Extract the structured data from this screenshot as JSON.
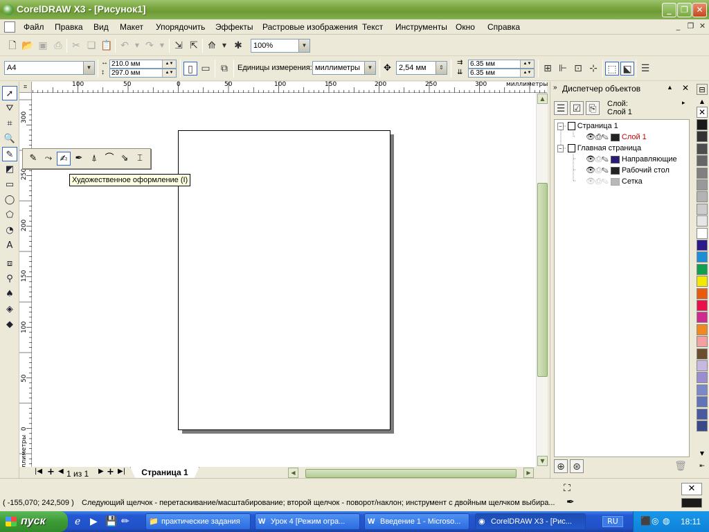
{
  "window": {
    "title": "CorelDRAW X3 - [Рисунок1]"
  },
  "menubar": {
    "items": [
      "Файл",
      "Правка",
      "Вид",
      "Макет",
      "Упорядочить",
      "Эффекты",
      "Растровые изображения",
      "Текст",
      "Инструменты",
      "Окно",
      "Справка"
    ]
  },
  "standard_toolbar": {
    "zoom": "100%"
  },
  "property_bar": {
    "paper_size": "A4",
    "width": "210.0 мм",
    "height": "297.0 мм",
    "units_label": "Единицы измерения:",
    "units_value": "миллиметры",
    "nudge": "2,54 мм",
    "dup_x": "6.35 мм",
    "dup_y": "6.35 мм"
  },
  "flyout": {
    "tooltip": "Художественное оформление (I)"
  },
  "ruler": {
    "h_labels": [
      "100",
      "50",
      "0",
      "50",
      "100",
      "150",
      "200",
      "250",
      "300"
    ],
    "h_units": "миллиметры",
    "v_labels": [
      "300",
      "250",
      "200",
      "150",
      "100",
      "50",
      "0"
    ],
    "v_units": "миллиметры"
  },
  "page_nav": {
    "counter": "1 из 1",
    "tab": "Страница 1"
  },
  "docker": {
    "title": "Диспетчер объектов",
    "layer_label": "Слой:",
    "layer_value": "Слой 1",
    "tree": [
      {
        "label": "Страница 1",
        "type": "page"
      },
      {
        "label": "Слой 1",
        "type": "layer",
        "color": "#222222",
        "highlight": true
      },
      {
        "label": "Главная страница",
        "type": "page"
      },
      {
        "label": "Направляющие",
        "type": "layer",
        "color": "#2b1a7a"
      },
      {
        "label": "Рабочий стол",
        "type": "layer",
        "color": "#222222"
      },
      {
        "label": "Сетка",
        "type": "layer",
        "color": "#b8b8b8",
        "disabled": true
      }
    ]
  },
  "palette": {
    "colors": [
      "#1a1a1a",
      "#333333",
      "#4d4d4d",
      "#666666",
      "#808080",
      "#999999",
      "#b3b3b3",
      "#cccccc",
      "#e6e6e6",
      "#ffffff",
      "#2a1a8a",
      "#1e8fd6",
      "#12a050",
      "#f4e800",
      "#e85c0c",
      "#e8104a",
      "#d02a90",
      "#f08a20",
      "#f4a0a0",
      "#6b4e2e",
      "#c6b8e0",
      "#9a8ed0",
      "#7a8ac8",
      "#6274b8",
      "#4a5aa0",
      "#3a4a88"
    ]
  },
  "statusbar": {
    "coords": "( -155,070; 242,509 )",
    "message": "Следующий щелчок - перетаскивание/масштабирование; второй щелчок - поворот/наклон; инструмент с двойным щелчком выбира..."
  },
  "taskbar": {
    "start": "пуск",
    "tasks": [
      "практические задания",
      "Урок 4 [Режим огра...",
      "Введение 1 - Microso...",
      "CorelDRAW X3 - [Рис..."
    ],
    "lang": "RU",
    "clock": "18:11"
  }
}
